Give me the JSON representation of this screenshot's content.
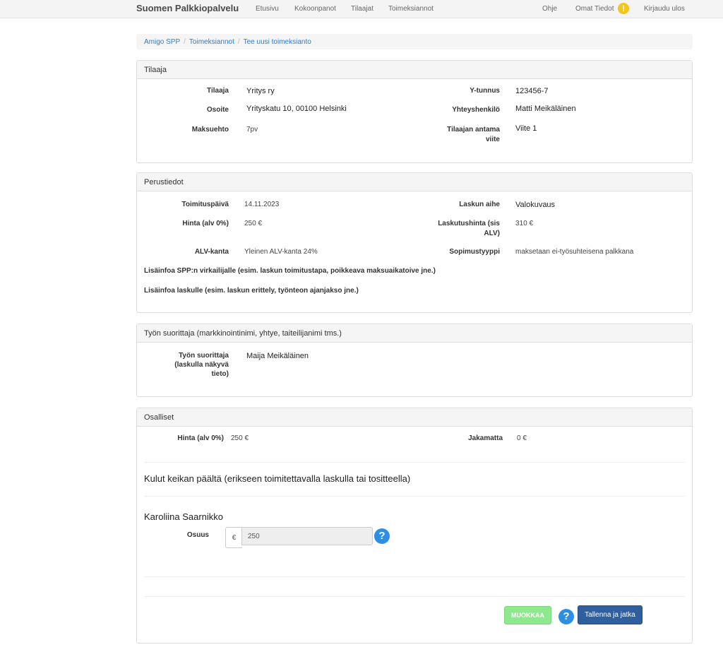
{
  "navbar": {
    "brand": "Suomen Palkkiopalvelu",
    "links": [
      "Etusivu",
      "Kokoonpanot",
      "Tilaajat",
      "Toimeksiannot"
    ],
    "right_links": {
      "help": "Ohje",
      "my_info": "Omat Tiedot",
      "warning_badge": "!",
      "logout": "Kirjaudu ulos"
    }
  },
  "breadcrumb": [
    "Amigo SPP",
    "Toimeksiannot",
    "Tee uusi toimeksianto"
  ],
  "tilaaja": {
    "heading": "Tilaaja",
    "rows": {
      "tilaaja_label": "Tilaaja",
      "tilaaja_value": "Yritys ry",
      "ytunnus_label": "Y-tunnus",
      "ytunnus_value": "123456-7",
      "osoite_label": "Osoite",
      "osoite_value": "Yrityskatu 10, 00100 Helsinki",
      "yhteys_label": "Yhteyshenkilö",
      "yhteys_value": "Matti Meikäläinen",
      "maksuehto_label": "Maksuehto",
      "maksuehto_value": "7pv",
      "viite_label_1": "Tilaajan antama",
      "viite_label_2": "viite",
      "viite_value": "Viite 1"
    }
  },
  "perustiedot": {
    "heading": "Perustiedot",
    "rows": {
      "toimituspaiva_label": "Toimituspäivä",
      "toimituspaiva_value": "14.11.2023",
      "aihe_label": "Laskun aihe",
      "aihe_value": "Valokuvaus",
      "hinta_label": "Hinta (alv 0%)",
      "hinta_value": "250 €",
      "laskutushinta_label_1": "Laskutushinta (sis",
      "laskutushinta_label_2": "ALV)",
      "laskutushinta_value": "310 €",
      "alv_label": "ALV-kanta",
      "alv_value": "Yleinen ALV-kanta 24%",
      "sopimus_label": "Sopimustyyppi",
      "sopimus_value": "maksetaan ei-työsuhteisena palkkana",
      "lisainfo_spp": "Lisäinfoa SPP:n virkailijalle (esim. laskun toimitustapa, poikkeava maksuaikatoive jne.)",
      "lisainfo_lasku": "Lisäinfoa laskulle (esim. laskun erittely, työnteon ajanjakso jne.)"
    }
  },
  "suorittaja": {
    "heading": "Työn suorittaja (markkinointinimi, yhtye, taiteilijanimi tms.)",
    "label_1": "Työn suorittaja",
    "label_2": "(laskulla näkyvä",
    "label_3": "tieto)",
    "value": "Maija Meikäläinen"
  },
  "osalliset": {
    "heading": "Osalliset",
    "hinta_label": "Hinta (alv 0%)",
    "hinta_value": "250 €",
    "jakamatta_label": "Jakamatta",
    "jakamatta_value": "0 €",
    "kulut_title": "Kulut keikan päältä (erikseen toimitettavalla laskulla tai tositteella)",
    "person_name": "Karoliina Saarnikko",
    "osuus_label": "Osuus",
    "currency": "€",
    "osuus_value": "250",
    "help_glyph": "?",
    "muokkaa_label": "MUOKKAA",
    "save_label": "Tallenna ja jatka"
  },
  "colors": {
    "link": "#2a7ec6",
    "help": "#2d8ee6",
    "save": "#2f5f9e",
    "muokkaa": "#8ee88e",
    "warning": "#f5c518"
  }
}
